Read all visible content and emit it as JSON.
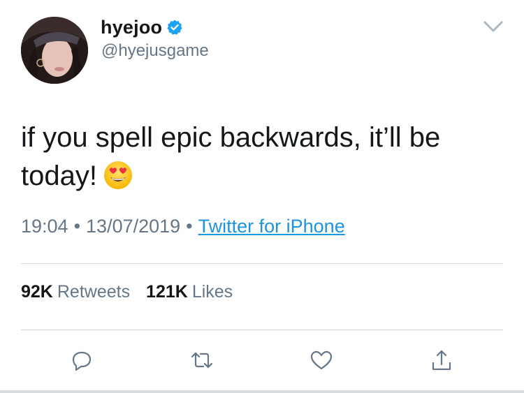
{
  "user": {
    "display_name": "hyejoo",
    "handle": "@hyejusgame",
    "verified": true
  },
  "tweet": {
    "text": "if you spell epic backwards, it’ll be today!",
    "emoji": "heart-eyes"
  },
  "meta": {
    "time": "19:04",
    "date": "13/07/2019",
    "separator": "•",
    "source": "Twitter for iPhone"
  },
  "stats": {
    "retweets_count": "92K",
    "retweets_label": "Retweets",
    "likes_count": "121K",
    "likes_label": "Likes"
  },
  "colors": {
    "link": "#1b95e0",
    "verified": "#1da1f2",
    "secondary_text": "#657786",
    "primary_text": "#14171a"
  },
  "icons": [
    "chevron-down-icon",
    "verified-badge-icon",
    "reply-icon",
    "retweet-icon",
    "like-icon",
    "share-icon"
  ]
}
